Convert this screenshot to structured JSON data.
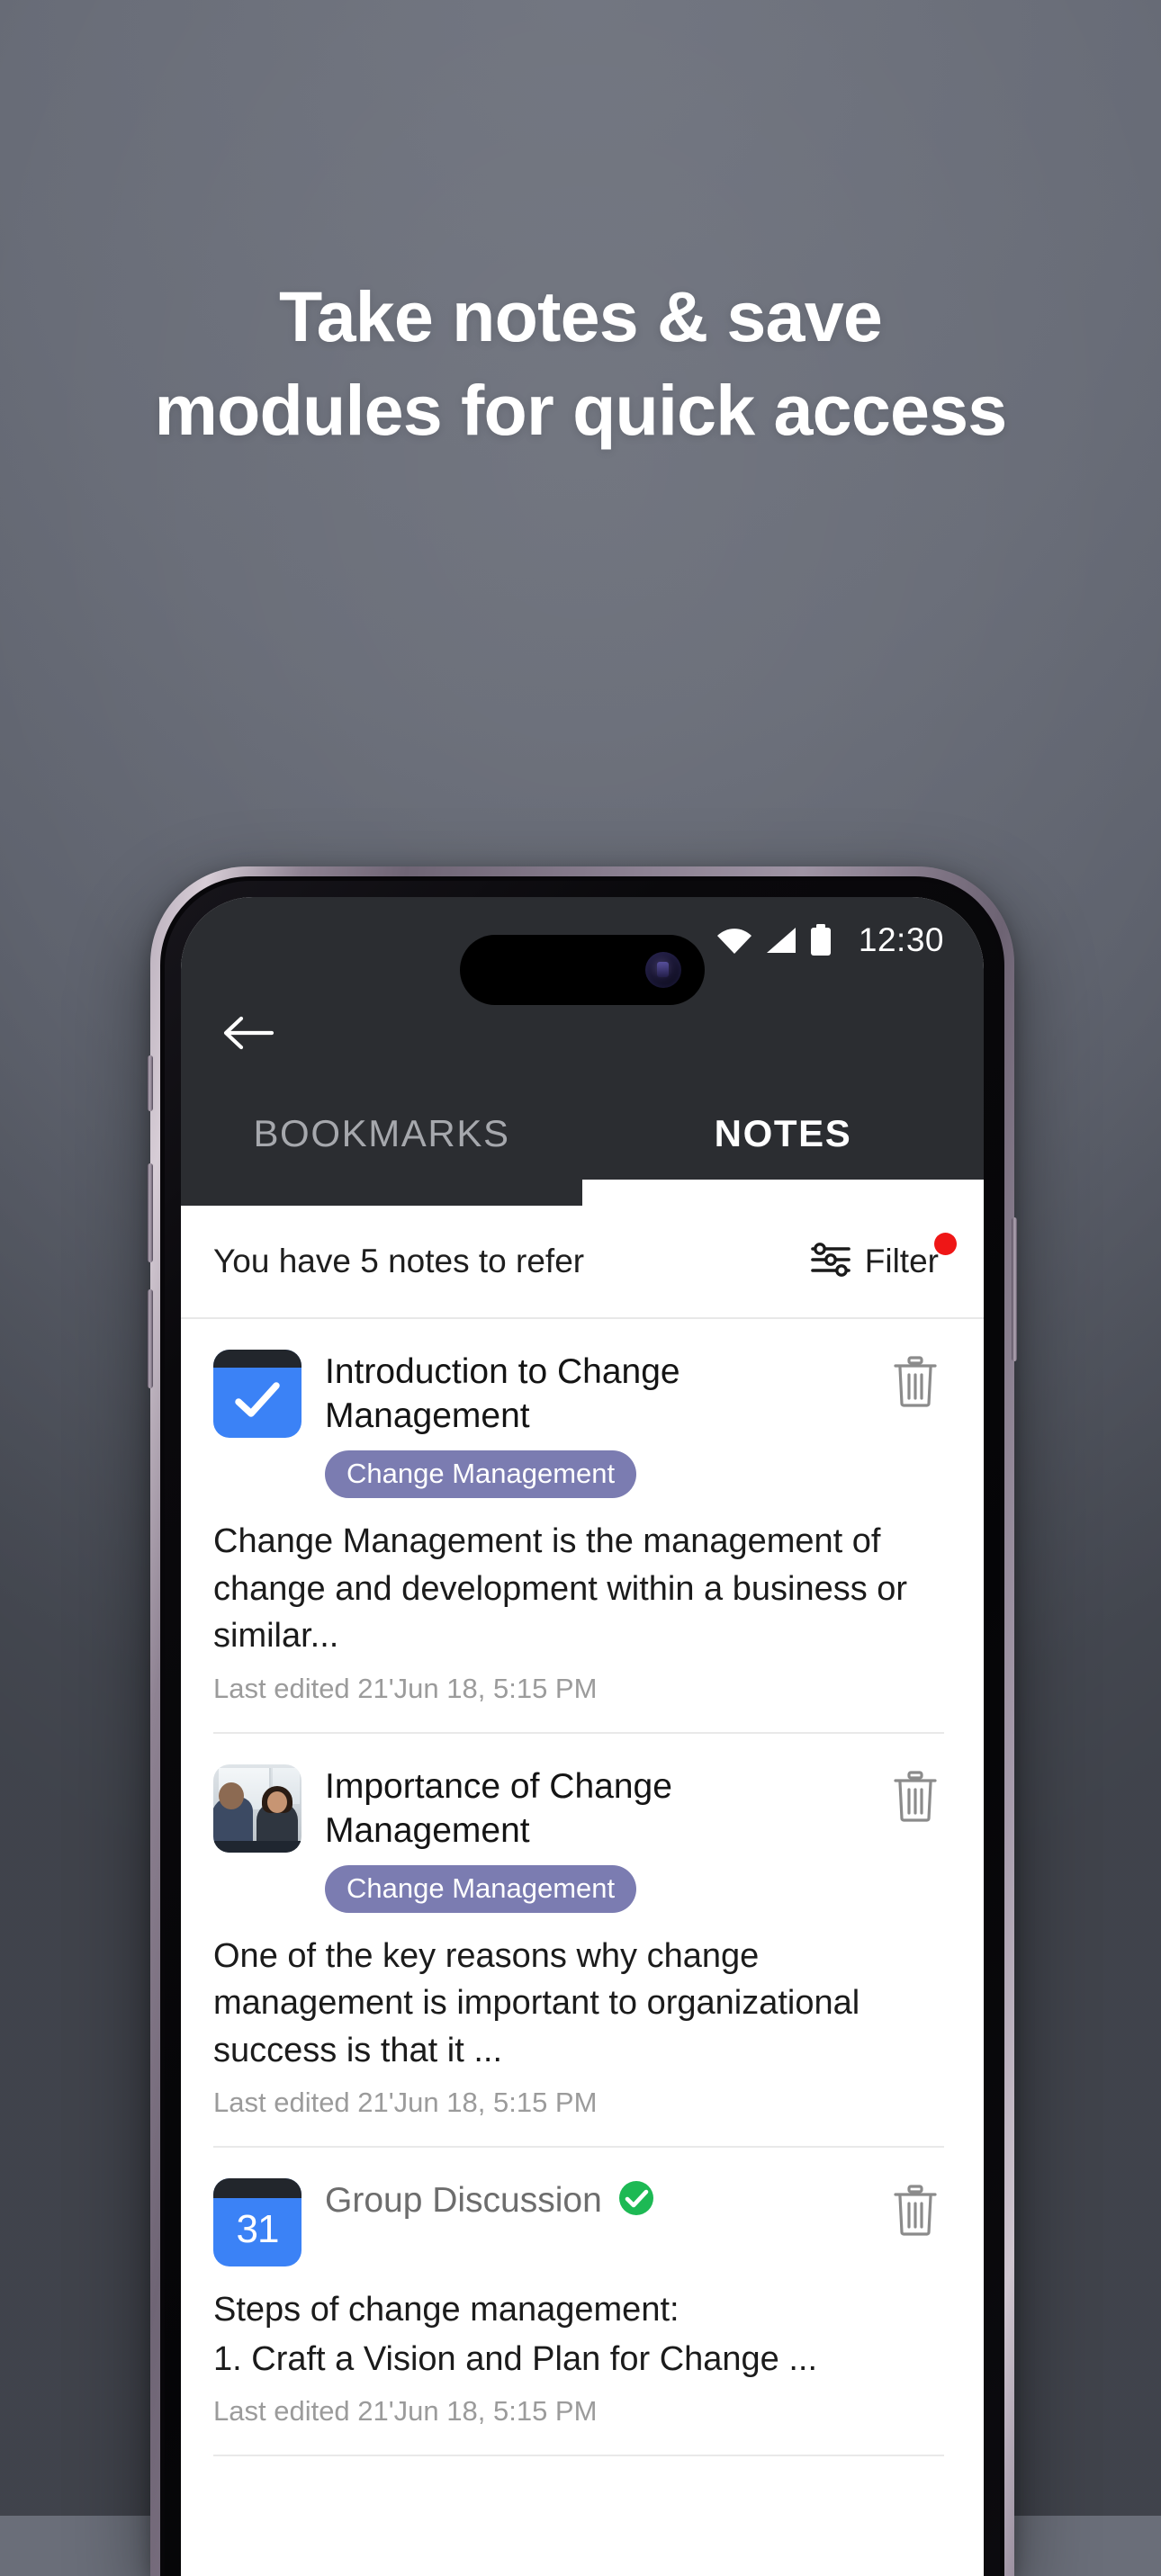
{
  "promo": {
    "headline_line1": "Take notes & save",
    "headline_line2": "modules for quick access",
    "background_color": "#686c77",
    "headline_color": "#ffffff"
  },
  "phone": {
    "frame_color": "#9b90a0",
    "bezel_color": "#08070a"
  },
  "status_bar": {
    "wifi_icon": "wifi-icon",
    "signal_icon": "cellular-signal-icon",
    "battery_icon": "battery-full-icon",
    "time": "12:30"
  },
  "app_bar": {
    "background_color": "#2b2d31",
    "back_icon": "arrow-left-icon",
    "tabs": [
      {
        "label": "BOOKMARKS",
        "active": false
      },
      {
        "label": "NOTES",
        "active": true
      }
    ]
  },
  "summary": {
    "text": "You have 5 notes to refer",
    "filter_label": "Filter",
    "filter_icon": "sliders-filter-icon",
    "badge_color": "#ef1616",
    "has_badge": true
  },
  "notes": [
    {
      "thumbnail": "task-checkbox-icon",
      "title": "Introduction to Change Management",
      "tag": "Change Management",
      "tag_color": "#7b7cb1",
      "body": "Change Management is the management of change and development within a business or similar...",
      "meta": "Last edited 21'Jun 18, 5:15 PM",
      "delete_icon": "trash-icon",
      "status_icon": null
    },
    {
      "thumbnail": "meeting-photo-thumbnail",
      "title": "Importance of Change Management",
      "tag": "Change Management",
      "tag_color": "#7b7cb1",
      "body": "One of the key reasons why change management is important to organizational success is that it ...",
      "meta": "Last edited 21'Jun 18, 5:15 PM",
      "delete_icon": "trash-icon",
      "status_icon": null
    },
    {
      "thumbnail": "calendar-icon",
      "thumbnail_day": "31",
      "title": "Group Discussion",
      "tag": null,
      "body": "Steps of change management:\n1. Craft a Vision and Plan for Change ...",
      "body_line1": "Steps of change management:",
      "body_line2": "1. Craft a Vision and Plan for Change ...",
      "meta": "Last edited 21'Jun 18, 5:15 PM",
      "delete_icon": "trash-icon",
      "status_icon": "completed-check-icon",
      "status_color": "#1db954"
    }
  ]
}
